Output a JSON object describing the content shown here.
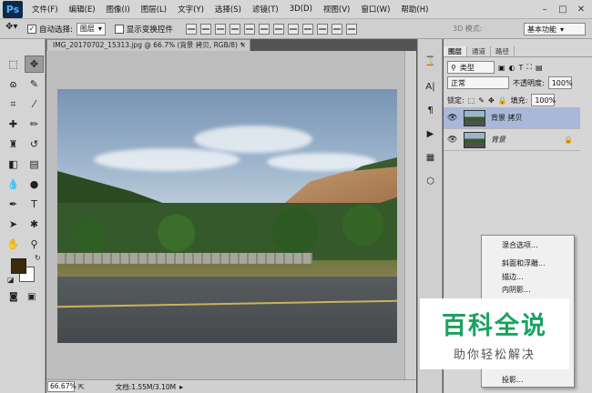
{
  "app": {
    "logo": "Ps"
  },
  "menubar": {
    "items": [
      "文件(F)",
      "编辑(E)",
      "图像(I)",
      "图层(L)",
      "文字(Y)",
      "选择(S)",
      "滤镜(T)",
      "3D(D)",
      "视图(V)",
      "窗口(W)",
      "帮助(H)"
    ],
    "window_controls": [
      "–",
      "□",
      "✕"
    ]
  },
  "options_bar": {
    "auto_select_label": "自动选择:",
    "auto_select_value": "图层",
    "show_transform_label": "显示变换控件",
    "mode_3d_label": "3D 模式:",
    "workspace_value": "基本功能"
  },
  "document": {
    "tab_title": "IMG_20170702_15313.jpg @ 66.7% (背景 拷贝, RGB/8) *",
    "tab_close": "×"
  },
  "statusbar": {
    "zoom": "66.67%",
    "doc_info": "文档:1.55M/3.10M"
  },
  "layers_panel": {
    "tabs": [
      "图层",
      "通道",
      "路径"
    ],
    "filter_kind": "类型",
    "blend_mode": "正常",
    "opacity_label": "不透明度:",
    "opacity_value": "100%",
    "lock_label": "锁定:",
    "fill_label": "填充:",
    "fill_value": "100%",
    "layers": [
      {
        "name": "背景 拷贝",
        "selected": true
      },
      {
        "name": "背景",
        "selected": false,
        "locked": true
      }
    ]
  },
  "context_menu": {
    "items": [
      "混合选项...",
      "斜面和浮雕...",
      "描边...",
      "内阴影...",
      "投影..."
    ]
  },
  "watermark": {
    "title": "百科全说",
    "subtitle": "助你轻松解决"
  },
  "colors": {
    "foreground": "#3c2a0b",
    "background": "#ffffff",
    "selected_layer": "#a9b8d8",
    "watermark_green": "#1aa260"
  }
}
